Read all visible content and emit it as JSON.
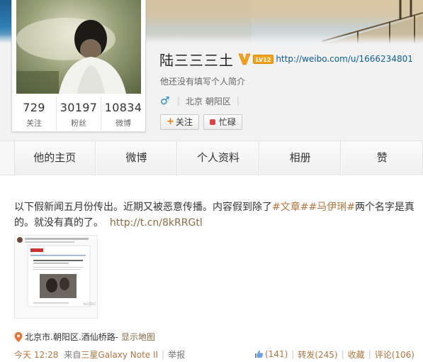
{
  "profile": {
    "name": "陆三三三土",
    "level_badge": "LV12",
    "url": "http://weibo.com/u/1666234801",
    "bio": "他还没有填写个人简介",
    "gender_symbol": "♂",
    "location": "北京 朝阳区",
    "stats": [
      {
        "value": "729",
        "label": "关注"
      },
      {
        "value": "30197",
        "label": "粉丝"
      },
      {
        "value": "10834",
        "label": "微博"
      }
    ],
    "follow_plus": "+",
    "follow_label": "关注",
    "secret_label": "忙碌"
  },
  "tabs": [
    "他的主页",
    "微博",
    "个人资料",
    "相册",
    "赞"
  ],
  "post": {
    "text_before": "以下假新闻五月份传出。近期又被恶意传播。内容假到除了",
    "tag1": "#文章#",
    "tag2": "#马伊琍#",
    "text_after": "两个名字是真的。就没有真的了。",
    "short_link": "http://t.cn/8kRRGtl",
    "location": "北京市.朝阳区.酒仙桥路",
    "location_sep": " - ",
    "map_label": "显示地图",
    "time": "今天 12:28",
    "from_label": "来自",
    "device": "三星Galaxy Note II",
    "report": "举报",
    "likes": "(141)",
    "reposts": "转发(245)",
    "favorite": "收藏",
    "comments": "评论(106)"
  },
  "colors": {
    "link": "#b3743c",
    "url": "#0a5e9a",
    "badge": "#f3a21a",
    "gender": "#1e88d6"
  }
}
